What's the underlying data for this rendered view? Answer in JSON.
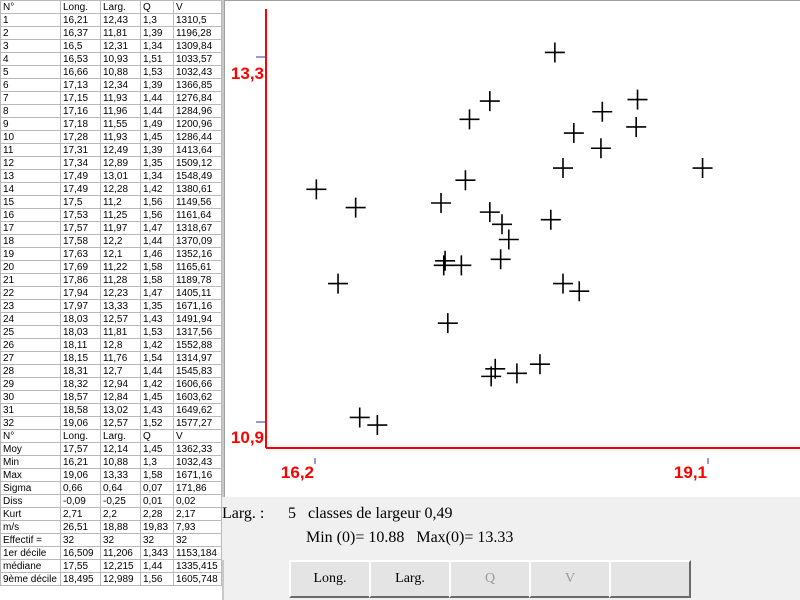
{
  "table": {
    "header": [
      "N°",
      "Long.",
      "Larg.",
      "Q",
      "V"
    ],
    "rows": [
      [
        "1",
        "16,21",
        "12,43",
        "1,3",
        "1310,5"
      ],
      [
        "2",
        "16,37",
        "11,81",
        "1,39",
        "1196,28"
      ],
      [
        "3",
        "16,5",
        "12,31",
        "1,34",
        "1309,84"
      ],
      [
        "4",
        "16,53",
        "10,93",
        "1,51",
        "1033,57"
      ],
      [
        "5",
        "16,66",
        "10,88",
        "1,53",
        "1032,43"
      ],
      [
        "6",
        "17,13",
        "12,34",
        "1,39",
        "1366,85"
      ],
      [
        "7",
        "17,15",
        "11,93",
        "1,44",
        "1276,84"
      ],
      [
        "8",
        "17,16",
        "11,96",
        "1,44",
        "1284,96"
      ],
      [
        "9",
        "17,18",
        "11,55",
        "1,49",
        "1200,96"
      ],
      [
        "10",
        "17,28",
        "11,93",
        "1,45",
        "1286,44"
      ],
      [
        "11",
        "17,31",
        "12,49",
        "1,39",
        "1413,64"
      ],
      [
        "12",
        "17,34",
        "12,89",
        "1,35",
        "1509,12"
      ],
      [
        "13",
        "17,49",
        "13,01",
        "1,34",
        "1548,49"
      ],
      [
        "14",
        "17,49",
        "12,28",
        "1,42",
        "1380,61"
      ],
      [
        "15",
        "17,5",
        "11,2",
        "1,56",
        "1149,56"
      ],
      [
        "16",
        "17,53",
        "11,25",
        "1,56",
        "1161,64"
      ],
      [
        "17",
        "17,57",
        "11,97",
        "1,47",
        "1318,67"
      ],
      [
        "18",
        "17,58",
        "12,2",
        "1,44",
        "1370,09"
      ],
      [
        "19",
        "17,63",
        "12,1",
        "1,46",
        "1352,16"
      ],
      [
        "20",
        "17,69",
        "11,22",
        "1,58",
        "1165,61"
      ],
      [
        "21",
        "17,86",
        "11,28",
        "1,58",
        "1189,78"
      ],
      [
        "22",
        "17,94",
        "12,23",
        "1,47",
        "1405,11"
      ],
      [
        "23",
        "17,97",
        "13,33",
        "1,35",
        "1671,16"
      ],
      [
        "24",
        "18,03",
        "12,57",
        "1,43",
        "1491,94"
      ],
      [
        "25",
        "18,03",
        "11,81",
        "1,53",
        "1317,56"
      ],
      [
        "26",
        "18,11",
        "12,8",
        "1,42",
        "1552,88"
      ],
      [
        "27",
        "18,15",
        "11,76",
        "1,54",
        "1314,97"
      ],
      [
        "28",
        "18,31",
        "12,7",
        "1,44",
        "1545,83"
      ],
      [
        "29",
        "18,32",
        "12,94",
        "1,42",
        "1606,66"
      ],
      [
        "30",
        "18,57",
        "12,84",
        "1,45",
        "1603,62"
      ],
      [
        "31",
        "18,58",
        "13,02",
        "1,43",
        "1649,62"
      ],
      [
        "32",
        "19,06",
        "12,57",
        "1,52",
        "1577,27"
      ]
    ],
    "stats_header": [
      "N°",
      "Long.",
      "Larg.",
      "Q",
      "V"
    ],
    "stats": [
      [
        "Moy",
        "17,57",
        "12,14",
        "1,45",
        "1362,33"
      ],
      [
        "Min",
        "16,21",
        "10,88",
        "1,3",
        "1032,43"
      ],
      [
        "Max",
        "19,06",
        "13,33",
        "1,58",
        "1671,16"
      ],
      [
        "Sigma",
        "0,66",
        "0,64",
        "0,07",
        "171,86"
      ],
      [
        "Diss",
        "-0,09",
        "-0,25",
        "0,01",
        "0,02"
      ],
      [
        "Kurt",
        "2,71",
        "2,2",
        "2,28",
        "2,17"
      ],
      [
        "m/s",
        "26,51",
        "18,88",
        "19,83",
        "7,93"
      ],
      [
        "Effectif =",
        "32",
        "32",
        "32",
        "32"
      ],
      [
        "1er décile",
        "16,509",
        "11,206",
        "1,343",
        "1153,184"
      ],
      [
        "médiane",
        "17,55",
        "12,215",
        "1,44",
        "1335,415"
      ],
      [
        "9ème décile",
        "18,495",
        "12,989",
        "1,56",
        "1605,748"
      ]
    ]
  },
  "chart_data": {
    "type": "scatter",
    "x_tick_labels": {
      "min": "16,2",
      "max": "19,1"
    },
    "y_tick_labels": {
      "min": "10,9",
      "max": "13,3"
    },
    "xlim": [
      16.2,
      19.1
    ],
    "ylim": [
      10.9,
      13.3
    ],
    "axis_color": "#ff0000",
    "marker": "plus",
    "points": [
      {
        "x": 16.21,
        "y": 12.43
      },
      {
        "x": 16.37,
        "y": 11.81
      },
      {
        "x": 16.5,
        "y": 12.31
      },
      {
        "x": 16.53,
        "y": 10.93
      },
      {
        "x": 16.66,
        "y": 10.88
      },
      {
        "x": 17.13,
        "y": 12.34
      },
      {
        "x": 17.15,
        "y": 11.93
      },
      {
        "x": 17.16,
        "y": 11.96
      },
      {
        "x": 17.18,
        "y": 11.55
      },
      {
        "x": 17.28,
        "y": 11.93
      },
      {
        "x": 17.31,
        "y": 12.49
      },
      {
        "x": 17.34,
        "y": 12.89
      },
      {
        "x": 17.49,
        "y": 13.01
      },
      {
        "x": 17.49,
        "y": 12.28
      },
      {
        "x": 17.5,
        "y": 11.2
      },
      {
        "x": 17.53,
        "y": 11.25
      },
      {
        "x": 17.57,
        "y": 11.97
      },
      {
        "x": 17.58,
        "y": 12.2
      },
      {
        "x": 17.63,
        "y": 12.1
      },
      {
        "x": 17.69,
        "y": 11.22
      },
      {
        "x": 17.86,
        "y": 11.28
      },
      {
        "x": 17.94,
        "y": 12.23
      },
      {
        "x": 17.97,
        "y": 13.33
      },
      {
        "x": 18.03,
        "y": 12.57
      },
      {
        "x": 18.03,
        "y": 11.81
      },
      {
        "x": 18.11,
        "y": 12.8
      },
      {
        "x": 18.15,
        "y": 11.76
      },
      {
        "x": 18.31,
        "y": 12.7
      },
      {
        "x": 18.32,
        "y": 12.94
      },
      {
        "x": 18.57,
        "y": 12.84
      },
      {
        "x": 18.58,
        "y": 13.02
      },
      {
        "x": 19.06,
        "y": 12.57
      }
    ]
  },
  "info": {
    "line1_label": "Larg. :",
    "line1_text": "5   classes de largeur 0,49",
    "line2_text": "Min (0)= 10.88   Max(0)= 13.33"
  },
  "buttons": [
    {
      "label": "Long.",
      "enabled": true
    },
    {
      "label": "Larg.",
      "enabled": true
    },
    {
      "label": "Q",
      "enabled": false
    },
    {
      "label": "V",
      "enabled": false
    },
    {
      "label": "",
      "enabled": true
    }
  ]
}
